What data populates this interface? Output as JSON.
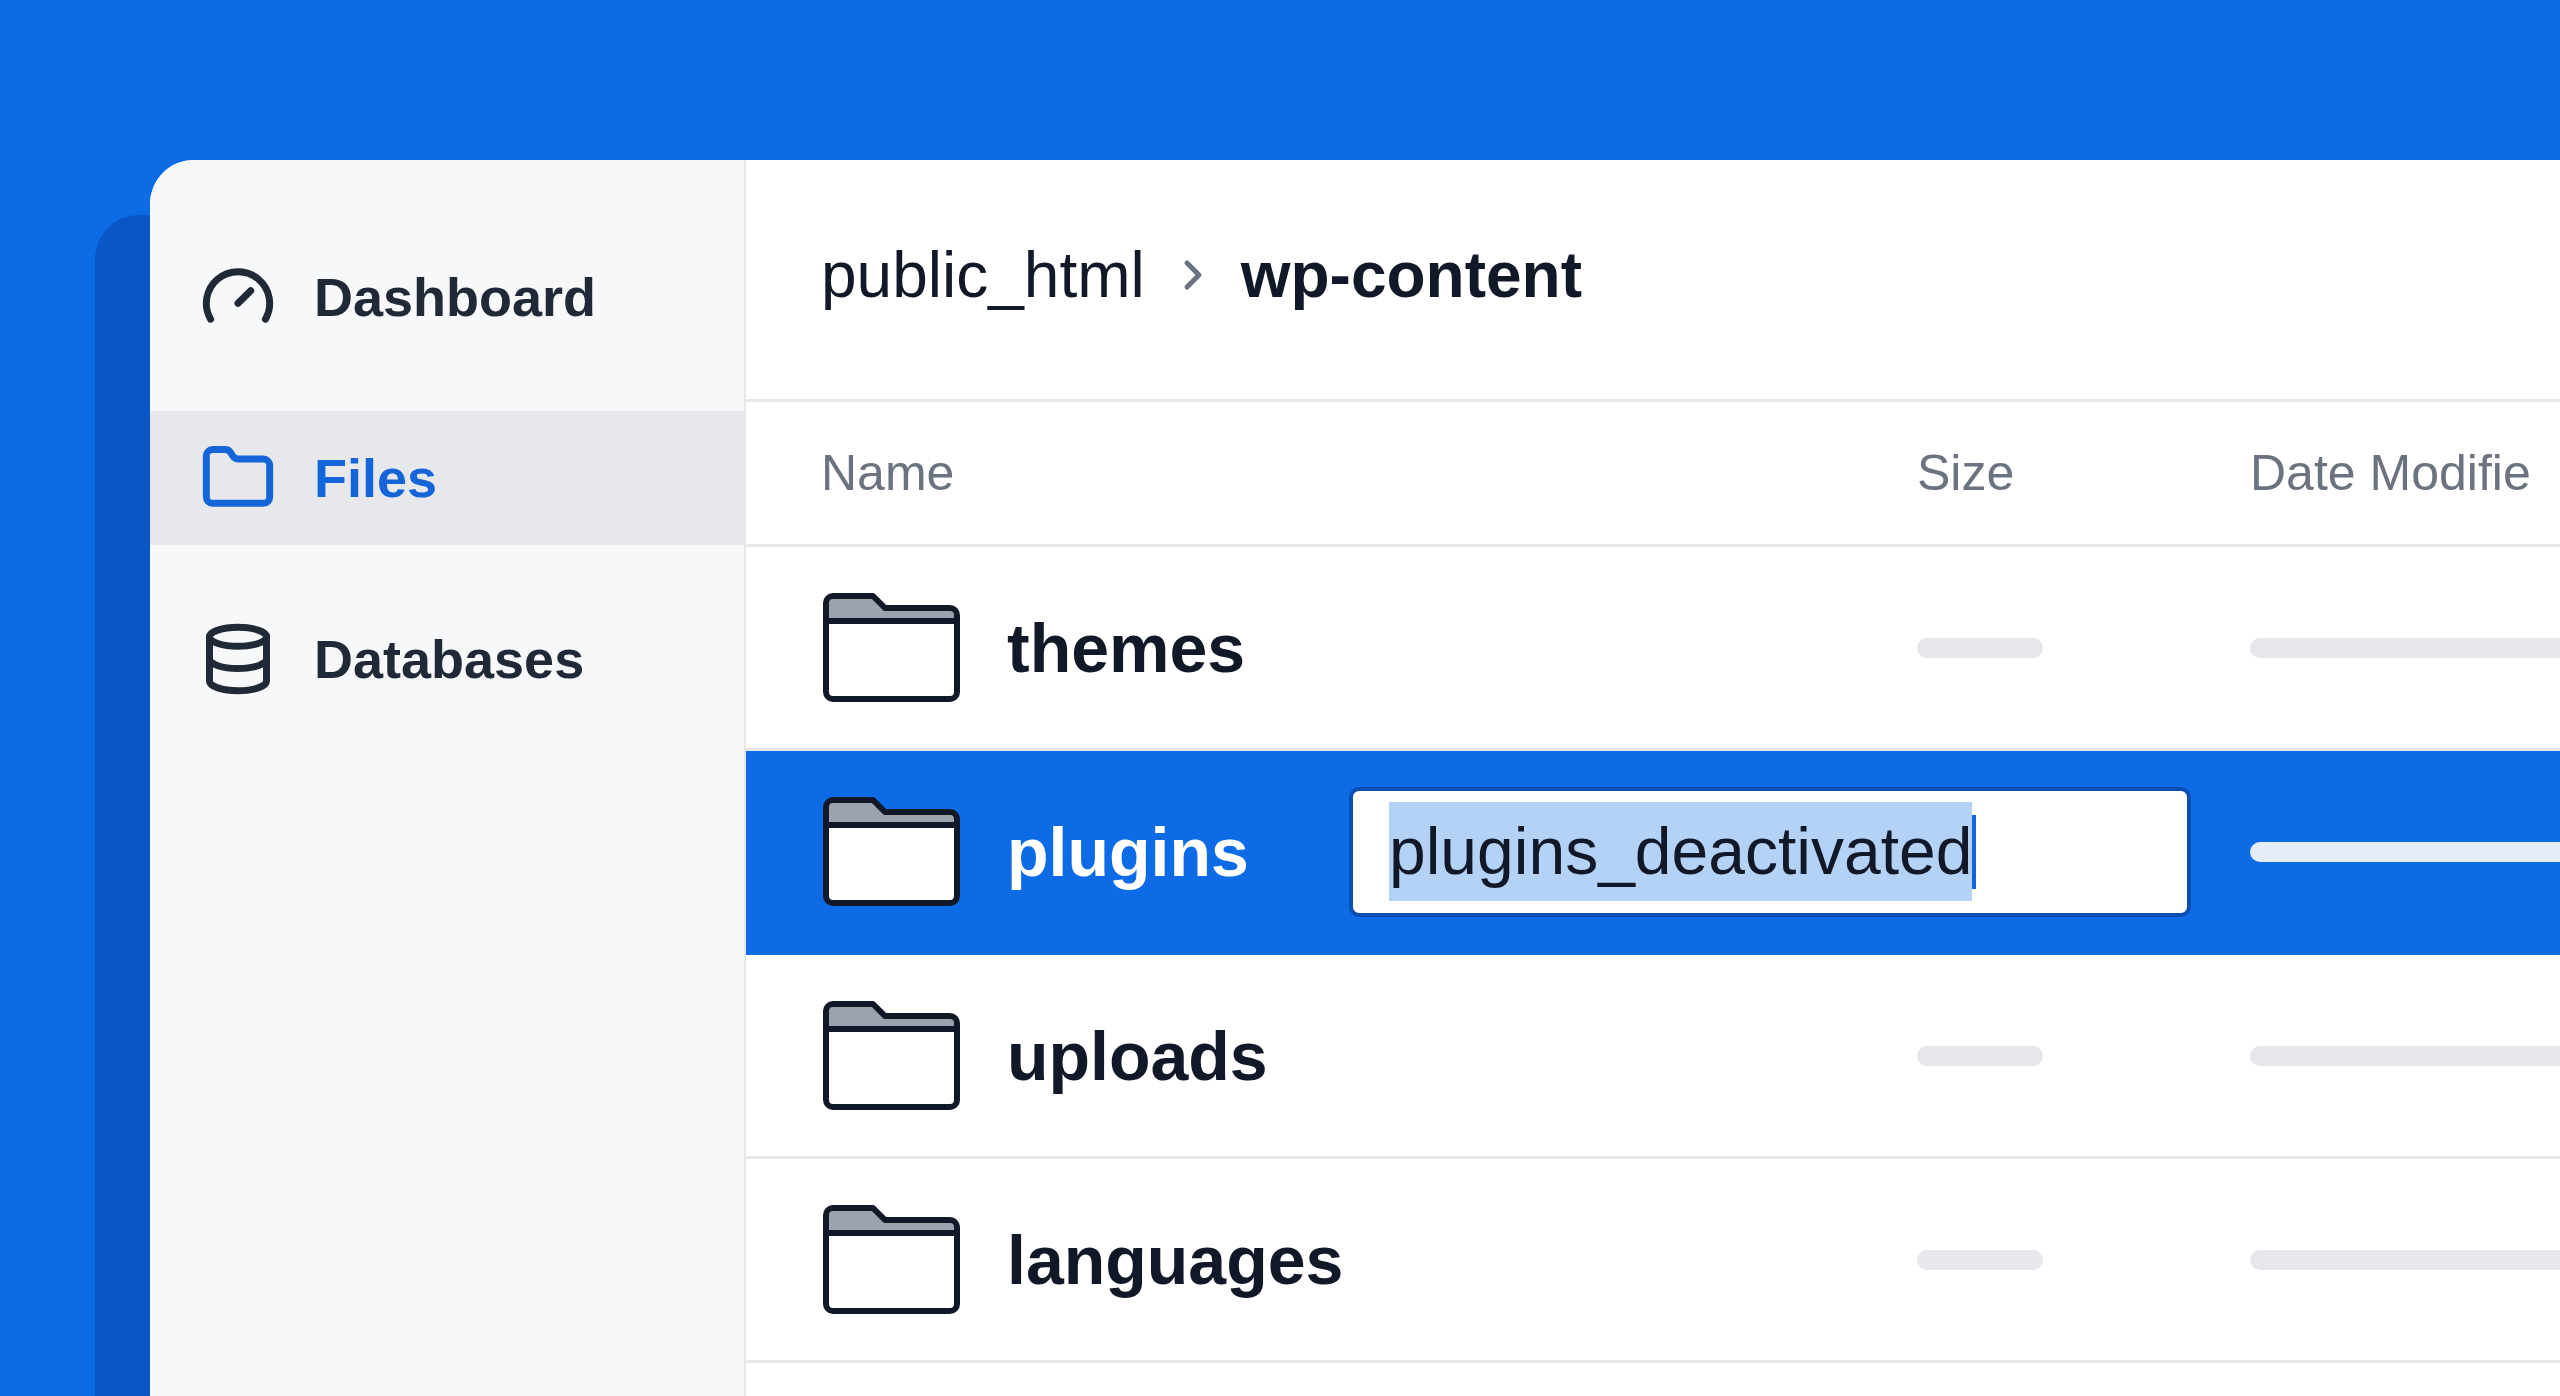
{
  "sidebar": {
    "items": [
      {
        "label": "Dashboard",
        "selected": false
      },
      {
        "label": "Files",
        "selected": true
      },
      {
        "label": "Databases",
        "selected": false
      }
    ]
  },
  "breadcrumb": [
    {
      "label": "public_html",
      "current": false
    },
    {
      "label": "wp-content",
      "current": true
    }
  ],
  "table": {
    "columns": [
      "Name",
      "Size",
      "Date Modifie"
    ],
    "rows": [
      {
        "name": "themes",
        "selected": false
      },
      {
        "name": "plugins",
        "selected": true,
        "rename_value": "plugins_deactivated"
      },
      {
        "name": "uploads",
        "selected": false
      },
      {
        "name": "languages",
        "selected": false
      }
    ]
  }
}
